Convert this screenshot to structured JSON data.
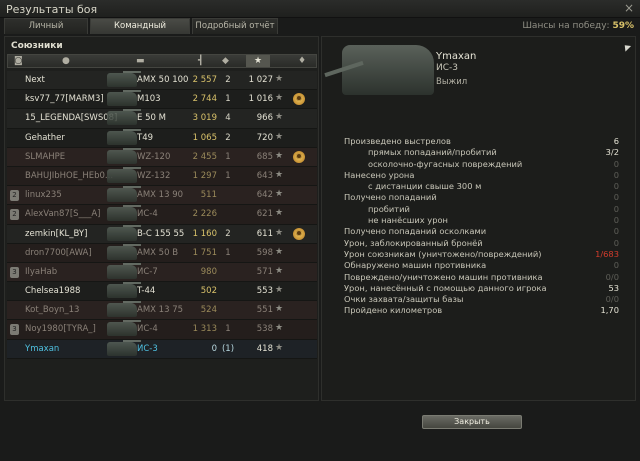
{
  "window": {
    "title": "Результаты боя",
    "close_glyph": "×"
  },
  "tabs": [
    {
      "label": "Личный результат",
      "active": false
    },
    {
      "label": "Командный результат",
      "active": true
    },
    {
      "label": "Подробный отчёт",
      "active": false
    }
  ],
  "win_chance": {
    "label": "Шансы на победу:",
    "value": "59%"
  },
  "allies": {
    "heading": "Союзники",
    "column_icons": [
      "platoon-icon",
      "player-icon",
      "tank-icon",
      "damage-icon",
      "kills-icon",
      "xp-icon",
      "medal-icon"
    ],
    "sorted_column": "xp",
    "rows": [
      {
        "name": "Next",
        "vehicle": "AMX 50 100",
        "damage": "2 557",
        "kills": "2",
        "xp": "1 027",
        "medal": false,
        "dead": false,
        "platoon": ""
      },
      {
        "name": "ksv77_77[MARM3]",
        "vehicle": "M103",
        "damage": "2 744",
        "kills": "1",
        "xp": "1 016",
        "medal": true,
        "dead": false,
        "platoon": ""
      },
      {
        "name": "15_LEGENDA[SWS08]",
        "vehicle": "E 50 M",
        "damage": "3 019",
        "kills": "4",
        "xp": "966",
        "medal": false,
        "dead": false,
        "platoon": ""
      },
      {
        "name": "Gehather",
        "vehicle": "T49",
        "damage": "1 065",
        "kills": "2",
        "xp": "720",
        "medal": false,
        "dead": false,
        "platoon": ""
      },
      {
        "name": "SLMAHPE",
        "vehicle": "WZ-120",
        "damage": "2 455",
        "kills": "1",
        "xp": "685",
        "medal": true,
        "dead": true,
        "platoon": ""
      },
      {
        "name": "BAHUJIbHOE_HEb0...",
        "vehicle": "WZ-132",
        "damage": "1 297",
        "kills": "1",
        "xp": "643",
        "medal": false,
        "dead": true,
        "platoon": ""
      },
      {
        "name": "linux235",
        "vehicle": "AMX 13 90",
        "damage": "511",
        "kills": "",
        "xp": "642",
        "medal": false,
        "dead": true,
        "platoon": "2"
      },
      {
        "name": "AlexVan87[S___A]",
        "vehicle": "ИС-4",
        "damage": "2 226",
        "kills": "",
        "xp": "621",
        "medal": false,
        "dead": true,
        "platoon": "2"
      },
      {
        "name": "zemkin[KL_BY]",
        "vehicle": "B-C 155 55",
        "damage": "1 160",
        "kills": "2",
        "xp": "611",
        "medal": true,
        "dead": false,
        "platoon": ""
      },
      {
        "name": "dron7700[AWA]",
        "vehicle": "AMX 50 B",
        "damage": "1 751",
        "kills": "1",
        "xp": "598",
        "medal": false,
        "dead": true,
        "platoon": ""
      },
      {
        "name": "IlyaHab",
        "vehicle": "ИС-7",
        "damage": "980",
        "kills": "",
        "xp": "571",
        "medal": false,
        "dead": true,
        "platoon": "3"
      },
      {
        "name": "Chelsea1988",
        "vehicle": "T-44",
        "damage": "502",
        "kills": "",
        "xp": "553",
        "medal": false,
        "dead": false,
        "platoon": ""
      },
      {
        "name": "Kot_Boyn_13",
        "vehicle": "AMX 13 75",
        "damage": "524",
        "kills": "",
        "xp": "551",
        "medal": false,
        "dead": true,
        "platoon": ""
      },
      {
        "name": "Noy1980[TYRA_]",
        "vehicle": "ИС-4",
        "damage": "1 313",
        "kills": "1",
        "xp": "538",
        "medal": false,
        "dead": true,
        "platoon": "3"
      },
      {
        "name": "Ymaxan",
        "vehicle": "ИС-3",
        "damage": "0",
        "kills": "(1)",
        "xp": "418",
        "medal": false,
        "dead": false,
        "self": true,
        "platoon": ""
      }
    ]
  },
  "player": {
    "name": "Ymaxan",
    "vehicle": "ИС-3",
    "status": "Выжил"
  },
  "stats": [
    {
      "label": "Произведено выстрелов",
      "value": "6",
      "indent": false,
      "style": ""
    },
    {
      "label": "прямых попаданий/пробитий",
      "value": "3/2",
      "indent": true,
      "style": ""
    },
    {
      "label": "осколочно-фугасных повреждений",
      "value": "0",
      "indent": true,
      "style": "zero"
    },
    {
      "label": "Нанесено урона",
      "value": "0",
      "indent": false,
      "style": "zero"
    },
    {
      "label": "с дистанции свыше 300 м",
      "value": "0",
      "indent": true,
      "style": "zero"
    },
    {
      "label": "Получено попаданий",
      "value": "0",
      "indent": false,
      "style": "zero"
    },
    {
      "label": "пробитий",
      "value": "0",
      "indent": true,
      "style": "zero"
    },
    {
      "label": "не нанёсших урон",
      "value": "0",
      "indent": true,
      "style": "zero"
    },
    {
      "label": "Получено попаданий осколками",
      "value": "0",
      "indent": false,
      "style": "zero"
    },
    {
      "label": "Урон, заблокированный бронёй",
      "value": "0",
      "indent": false,
      "style": "zero"
    },
    {
      "label": "Урон союзникам (уничтожено/повреждений)",
      "value": "1/683",
      "indent": false,
      "style": "red"
    },
    {
      "label": "Обнаружено машин противника",
      "value": "0",
      "indent": false,
      "style": "zero"
    },
    {
      "label": "Повреждено/уничтожено машин противника",
      "value": "0/0",
      "indent": false,
      "style": "zero"
    },
    {
      "label": "Урон, нанесённый с помощью данного игрока",
      "value": "53",
      "indent": false,
      "style": ""
    },
    {
      "label": "Очки захвата/защиты базы",
      "value": "0/0",
      "indent": false,
      "style": "zero"
    },
    {
      "label": "Пройдено километров",
      "value": "1,70",
      "indent": false,
      "style": ""
    }
  ],
  "buttons": {
    "close_label": "Закрыть"
  }
}
